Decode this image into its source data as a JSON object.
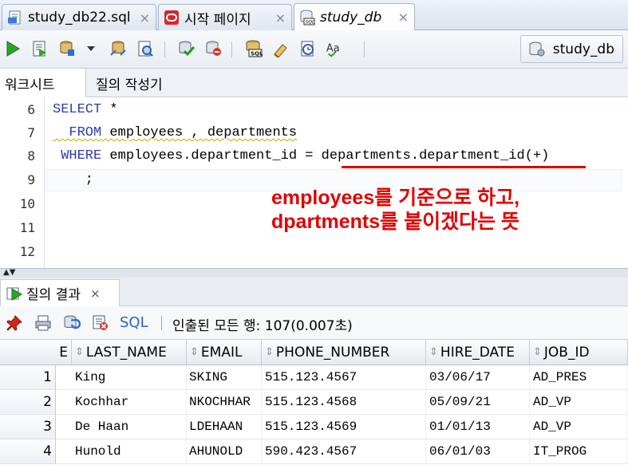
{
  "tabs": [
    {
      "label": "study_db22.sql",
      "icon": "sql-file-icon"
    },
    {
      "label": "시작 페이지",
      "icon": "oracle-icon"
    },
    {
      "label": "study_db",
      "icon": "sql-worksheet-icon",
      "active": true
    }
  ],
  "toolbar": {
    "buttons": [
      "run-statement-icon",
      "run-script-icon",
      "autotrace-icon",
      "dropdown-arrow-icon",
      "explain-plan-icon",
      "sql-tuning-icon",
      "commit-icon",
      "rollback-icon",
      "unshared-sql-icon",
      "clear-icon",
      "history-icon",
      "format-case-icon"
    ],
    "connection_label": "study_db"
  },
  "subtabs": {
    "worksheet": "워크시트",
    "query_builder": "질의 작성기"
  },
  "editor": {
    "line_numbers": [
      "6",
      "7",
      "8",
      "9",
      "10",
      "11",
      "12"
    ],
    "lines": [
      {
        "kw": "SELECT",
        "rest": " *"
      },
      {
        "kw": "  FROM",
        "rest": " employees , departments"
      },
      {
        "kw": " WHERE",
        "rest": " employees.department_id = departments.department_id(+)"
      },
      {
        "kw": "",
        "rest": "    ;"
      }
    ],
    "annotation": [
      "employees를 기준으로 하고,",
      "dpartments를 붙이겠다는 뜻"
    ],
    "accent_color": "#e00000"
  },
  "results": {
    "tab_label": "질의 결과",
    "sql_label": "SQL",
    "status": "인출된 모든 행: 107(0.007초)",
    "columns": [
      "E",
      "LAST_NAME",
      "EMAIL",
      "PHONE_NUMBER",
      "HIRE_DATE",
      "JOB_ID"
    ],
    "rows": [
      {
        "num": "1",
        "last_name": "King",
        "email": "SKING",
        "phone": "515.123.4567",
        "hire_date": "03/06/17",
        "job_id": "AD_PRES"
      },
      {
        "num": "2",
        "last_name": "Kochhar",
        "email": "NKOCHHAR",
        "phone": "515.123.4568",
        "hire_date": "05/09/21",
        "job_id": "AD_VP"
      },
      {
        "num": "3",
        "last_name": "De Haan",
        "email": "LDEHAAN",
        "phone": "515.123.4569",
        "hire_date": "01/01/13",
        "job_id": "AD_VP"
      },
      {
        "num": "4",
        "last_name": "Hunold",
        "email": "AHUNOLD",
        "phone": "590.423.4567",
        "hire_date": "06/01/03",
        "job_id": "IT_PROG"
      }
    ]
  }
}
